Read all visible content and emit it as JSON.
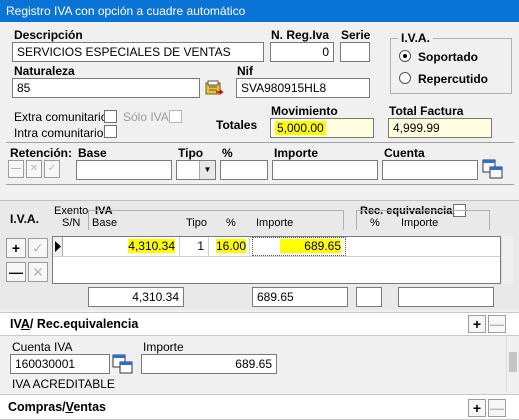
{
  "window": {
    "title": "Registro IVA con opción a cuadre automático"
  },
  "header": {
    "descripcion_label": "Descripción",
    "descripcion_value": "SERVICIOS ESPECIALES DE VENTAS",
    "nreg_label": "N. Reg.Iva",
    "nreg_value": "0",
    "serie_label": "Serie",
    "serie_value": "",
    "naturaleza_label": "Naturaleza",
    "naturaleza_value": "85",
    "nif_label": "Nif",
    "nif_value": "SVA980915HL8",
    "iva_group_label": "I.V.A.",
    "soportado_label": "Soportado",
    "repercutido_label": "Repercutido",
    "iva_selected": "Soportado"
  },
  "options": {
    "extra_comunitario": "Extra comunitario",
    "solo_iva": "Sólo IVA",
    "intra_comunitario": "Intra comunitario"
  },
  "totales": {
    "label": "Totales",
    "movimiento_label": "Movimiento",
    "movimiento_value": "5,000.00",
    "total_factura_label": "Total Factura",
    "total_factura_value": "4,999.99"
  },
  "retencion": {
    "label": "Retención:",
    "base_label": "Base",
    "tipo_label": "Tipo",
    "pct_label": "%",
    "importe_label": "Importe",
    "cuenta_label": "Cuenta"
  },
  "iva_grid": {
    "section_label": "I.V.A.",
    "exento_label": "Exento",
    "sn_label": "S/N",
    "iva_label": "IVA",
    "base_label": "Base",
    "tipo_label": "Tipo",
    "pct_label": "%",
    "importe_label": "Importe",
    "rec_label": "Rec. equivalencia",
    "rec_pct_label": "%",
    "rec_importe_label": "Importe",
    "rows": [
      {
        "base": "4,310.34",
        "tipo": "1",
        "pct": "16.00",
        "importe": "689.65"
      }
    ],
    "totals": {
      "base": "4,310.34",
      "importe": "689.65",
      "rec_pct": "",
      "rec_importe": ""
    }
  },
  "iva_rec_panel": {
    "title_part1": "IV",
    "title_underline": "A",
    "title_part2": "/ Rec.equivalencia",
    "cuenta_label": "Cuenta IVA",
    "cuenta_value": "160030001",
    "importe_label": "Importe",
    "importe_value": "689.65",
    "cuenta_desc": "IVA ACREDITABLE"
  },
  "compras_panel": {
    "title_part1": "Compras/",
    "title_underline": "V",
    "title_part2": "entas"
  },
  "colors": {
    "titlebar": "#0a74d6",
    "highlight": "#ffff00",
    "window_bg": "#f0f0f0"
  }
}
